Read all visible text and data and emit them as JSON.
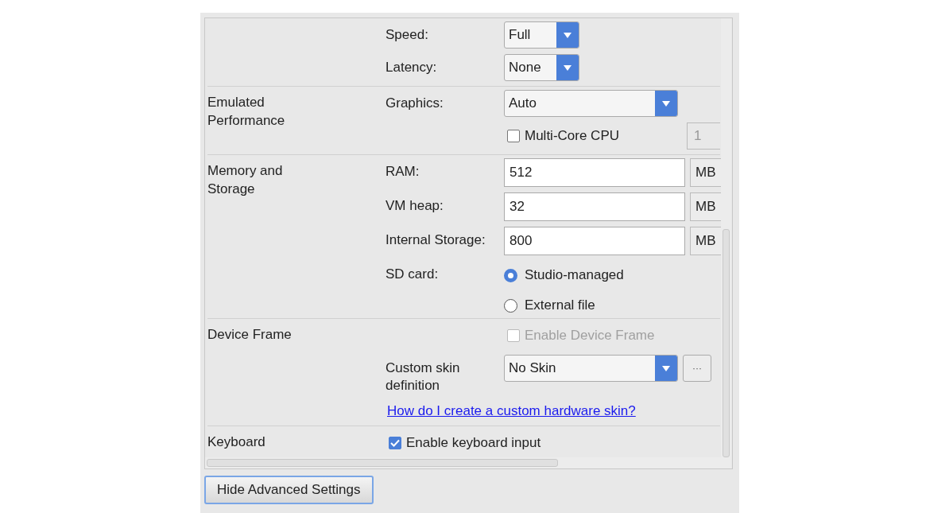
{
  "sections": [
    {
      "rows": [
        {
          "kind": "dropdown",
          "label": "Speed:",
          "value": "Full"
        },
        {
          "kind": "dropdown",
          "label": "Latency:",
          "value": "None"
        }
      ]
    },
    {
      "title": "Emulated Performance",
      "rows": [
        {
          "kind": "dropdown",
          "label": "Graphics:",
          "value": "Auto"
        },
        {
          "kind": "checkbox",
          "text": "Multi-Core CPU",
          "checked": false,
          "disabled": false,
          "spinner": "1"
        }
      ]
    },
    {
      "title": "Memory and Storage",
      "rows": [
        {
          "kind": "field",
          "label": "RAM:",
          "value": "512",
          "unit": "MB"
        },
        {
          "kind": "field",
          "label": "VM heap:",
          "value": "32",
          "unit": "MB"
        },
        {
          "kind": "field",
          "label": "Internal Storage:",
          "value": "800",
          "unit": "MB"
        },
        {
          "kind": "radio",
          "label": "SD card:",
          "options": [
            {
              "text": "Studio-managed",
              "selected": true
            },
            {
              "text": "External file",
              "selected": false
            }
          ]
        }
      ]
    },
    {
      "title": "Device Frame",
      "rows": [
        {
          "kind": "checkbox",
          "text": "Enable Device Frame",
          "checked": false,
          "disabled": true
        },
        {
          "kind": "dropdown",
          "label": "Custom skin definition",
          "value": "No Skin",
          "more": "···"
        },
        {
          "kind": "link",
          "text": "How do I create a custom hardware skin?"
        }
      ]
    },
    {
      "title": "Keyboard",
      "rows": [
        {
          "kind": "checkbox",
          "text": "Enable keyboard input",
          "checked": true,
          "disabled": false,
          "inline": true
        }
      ]
    }
  ],
  "button": "Hide Advanced Settings"
}
